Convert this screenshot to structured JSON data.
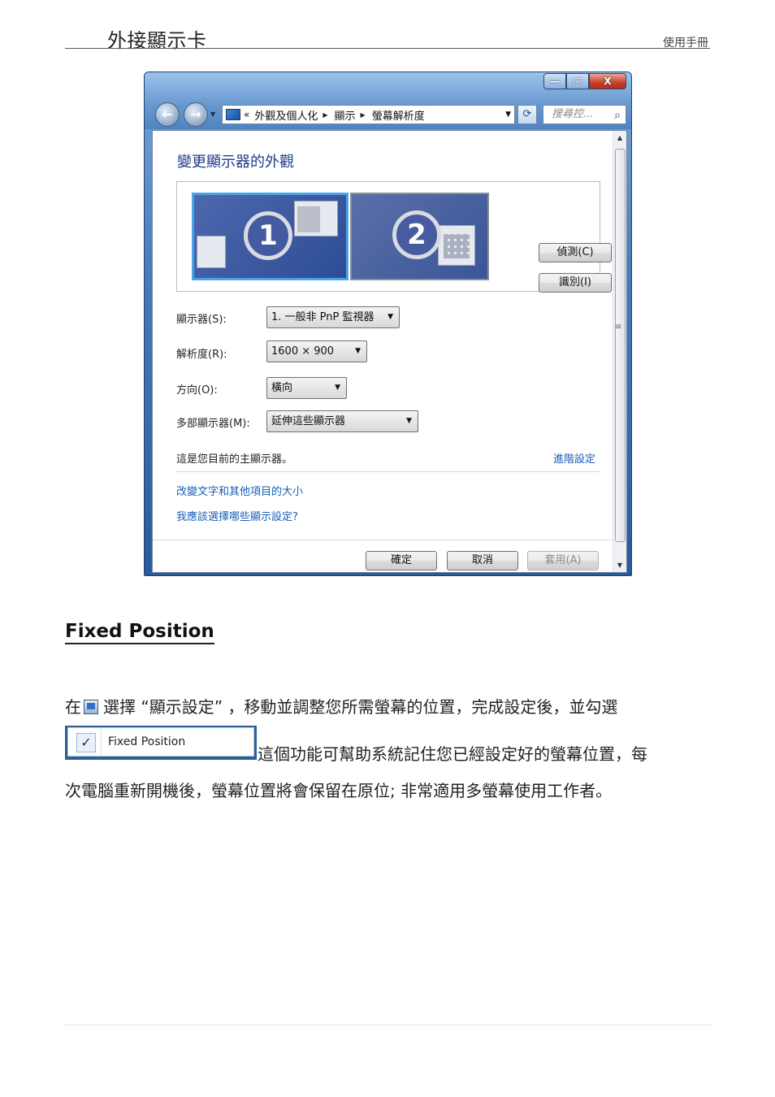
{
  "header": {
    "title": "外接顯示卡",
    "right": "使用手冊"
  },
  "dialog": {
    "caption_buttons": {
      "minimize": "—",
      "maximize": "□",
      "close": "X"
    },
    "nav": {
      "back": "←",
      "forward": "→"
    },
    "address": {
      "prefix": "«",
      "crumbs": [
        "外觀及個人化",
        "顯示",
        "螢幕解析度"
      ]
    },
    "search": {
      "placeholder": "搜尋控..."
    },
    "heading": "變更顯示器的外觀",
    "monitors": [
      "1",
      "2"
    ],
    "buttons": {
      "detect": "偵測(C)",
      "identify": "識別(I)",
      "ok": "確定",
      "cancel": "取消",
      "apply": "套用(A)"
    },
    "fields": {
      "display_label": "顯示器(S):",
      "display_value": "1. 一般非 PnP 監視器",
      "resolution_label": "解析度(R):",
      "resolution_value": "1600 × 900",
      "orientation_label": "方向(O):",
      "orientation_value": "橫向",
      "multi_label": "多部顯示器(M):",
      "multi_value": "延伸這些顯示器"
    },
    "status": "這是您目前的主顯示器。",
    "advanced_link": "進階設定",
    "links": [
      "改變文字和其他項目的大小",
      "我應該選擇哪些顯示設定?"
    ]
  },
  "section": {
    "title": "Fixed Position",
    "line1_a": "在",
    "line1_b": "選擇 “顯示設定” ，移動並調整您所需螢幕的位置，完成設定後，並勾選",
    "menu_item": "Fixed Position",
    "line2": "這個功能可幫助系統記住您已經設定好的螢幕位置，每",
    "line3": "次電腦重新開機後，螢幕位置將會保留在原位; 非常適用多螢幕使用工作者。"
  }
}
